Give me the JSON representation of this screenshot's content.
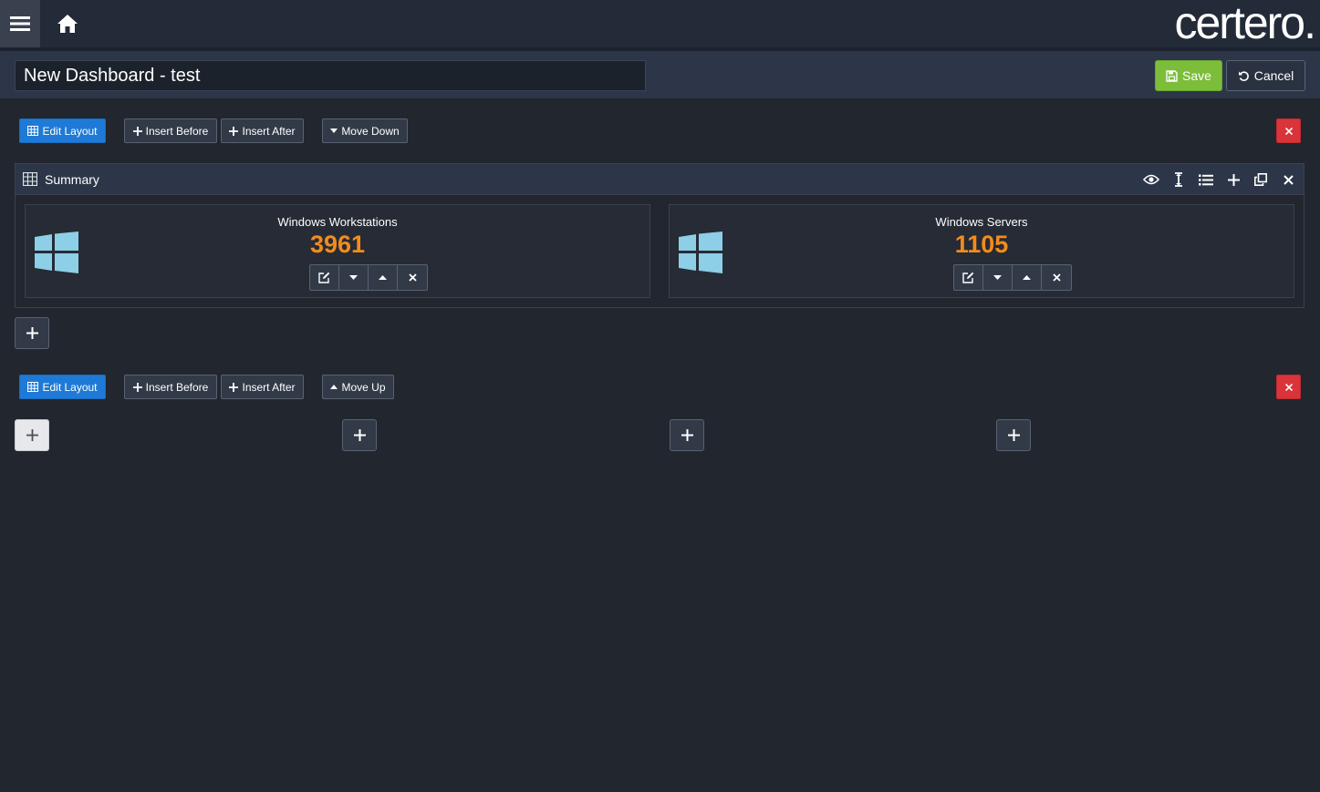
{
  "header": {
    "logo_text": "certero.",
    "menu_icon": "hamburger-icon",
    "home_icon": "home-icon"
  },
  "titlebar": {
    "dashboard_name": "New Dashboard - test",
    "save_label": "Save",
    "cancel_label": "Cancel"
  },
  "rows": [
    {
      "edit_layout_label": "Edit Layout",
      "insert_before_label": "Insert Before",
      "insert_after_label": "Insert After",
      "move_label": "Move Down"
    },
    {
      "edit_layout_label": "Edit Layout",
      "insert_before_label": "Insert Before",
      "insert_after_label": "Insert After",
      "move_label": "Move Up"
    }
  ],
  "panel": {
    "title": "Summary",
    "tools": [
      "eye-icon",
      "resize-vertical-icon",
      "list-icon",
      "plus-icon",
      "clone-icon",
      "close-icon"
    ],
    "tiles": [
      {
        "title": "Windows Workstations",
        "value": "3961"
      },
      {
        "title": "Windows Servers",
        "value": "1105"
      }
    ]
  },
  "colors": {
    "accent": "#1e7ad6",
    "save": "#7cbd3a",
    "danger": "#d9343a",
    "value": "#f28c1c",
    "windows_logo": "#8ccfe6"
  }
}
